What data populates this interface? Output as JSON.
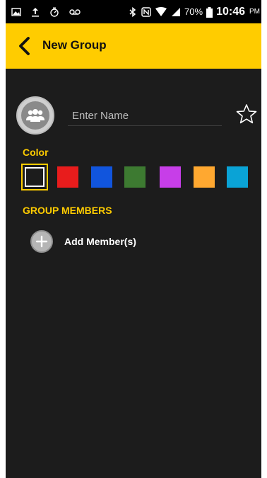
{
  "status_bar": {
    "battery_percent": "70%",
    "time": "10:46",
    "ampm": "PM",
    "icons_left": [
      "gallery-icon",
      "upload-icon",
      "timer-icon",
      "voicemail-icon"
    ],
    "icons_right": [
      "bluetooth-icon",
      "nfc-icon",
      "wifi-icon",
      "signal-icon",
      "battery-icon"
    ]
  },
  "header": {
    "title": "New Group"
  },
  "name_field": {
    "placeholder": "Enter Name",
    "value": ""
  },
  "color_section": {
    "label": "Color",
    "selected_index": 0,
    "swatches": [
      "#1c1c1c",
      "#e81c1c",
      "#1155dd",
      "#3d7a31",
      "#c73ee8",
      "#ffa830",
      "#0aa3d6"
    ]
  },
  "members_section": {
    "label": "GROUP MEMBERS",
    "add_label": "Add Member(s)"
  },
  "colors": {
    "accent": "#ffcc00",
    "background": "#1c1c1c"
  }
}
